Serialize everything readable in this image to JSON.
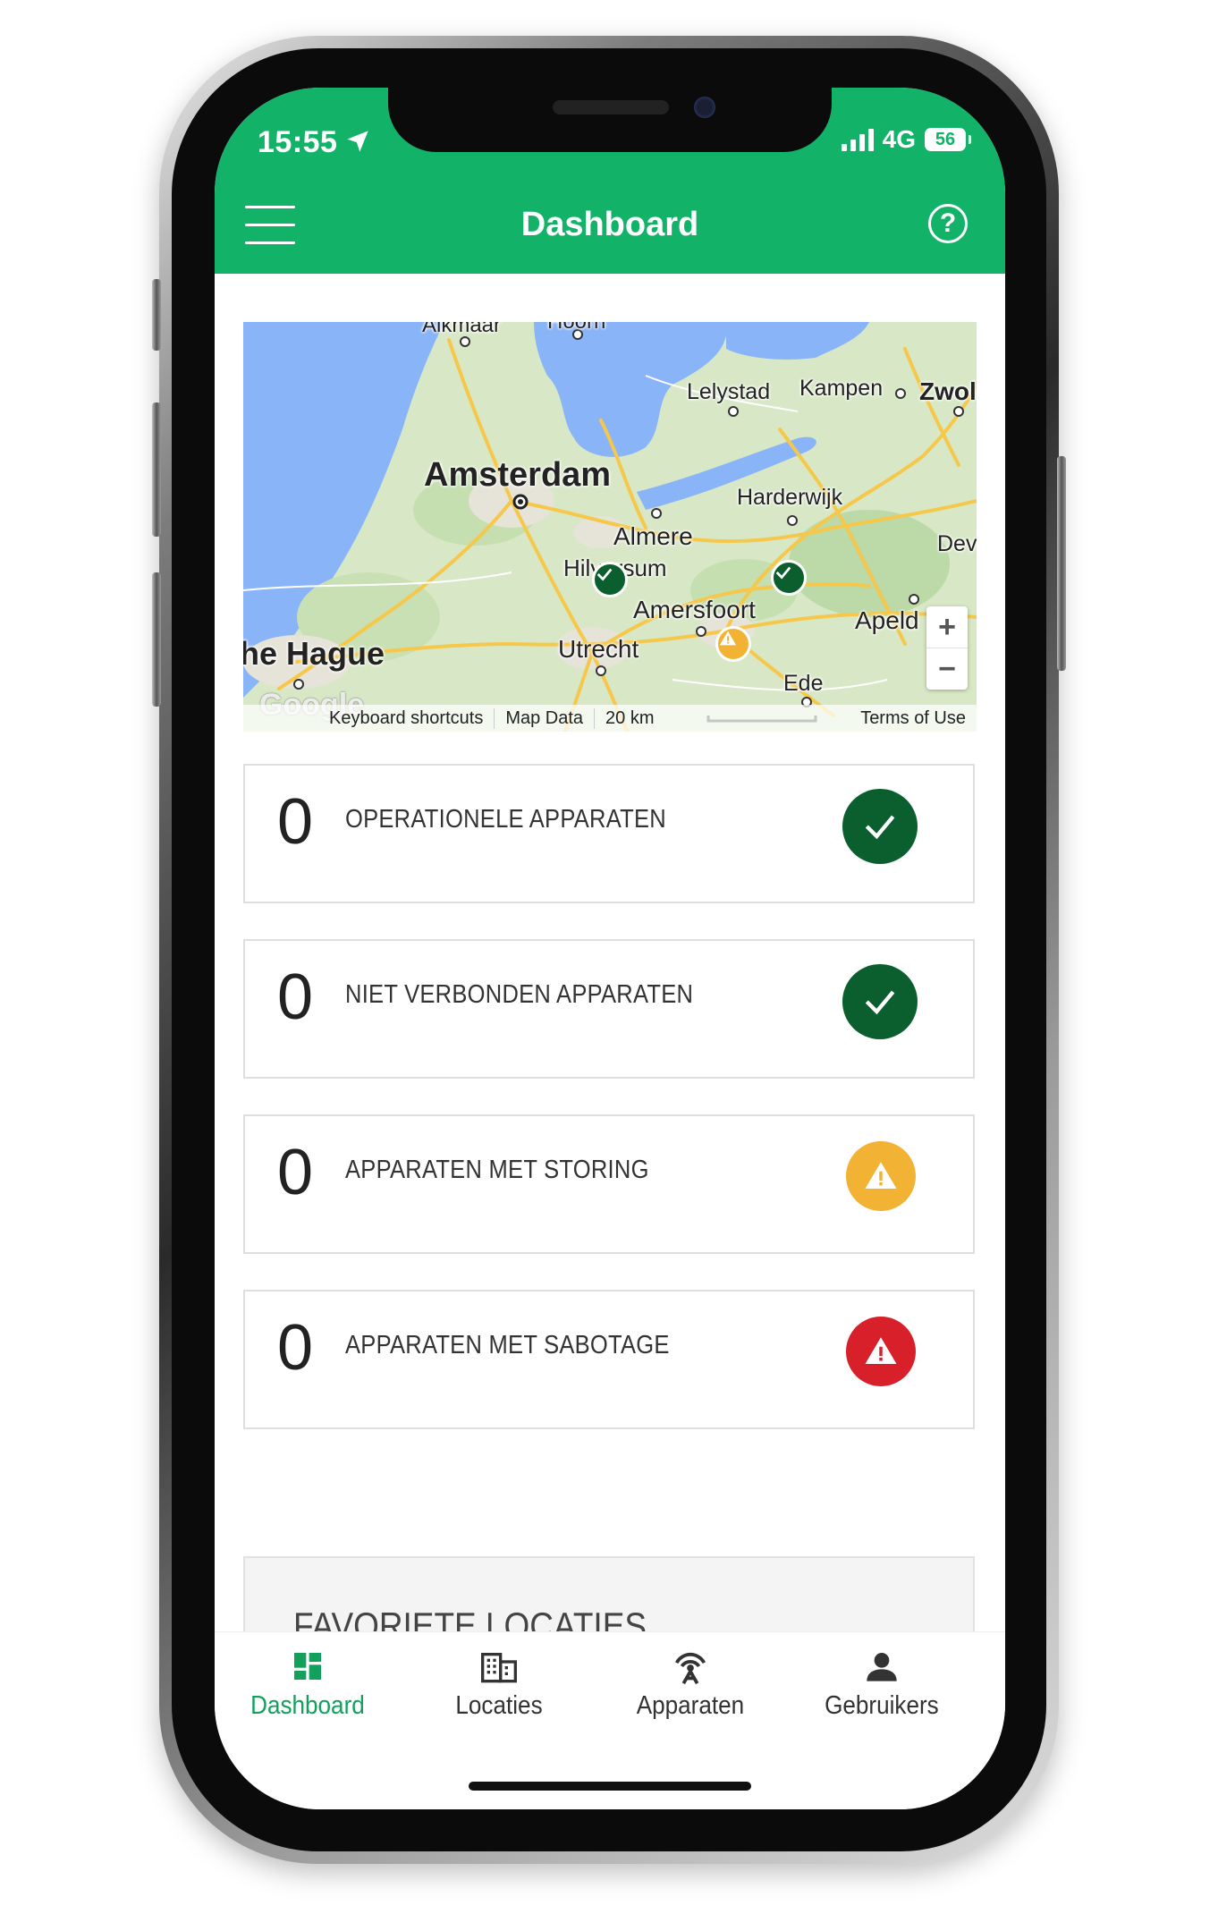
{
  "status_bar": {
    "time": "15:55",
    "network": "4G",
    "battery": "56"
  },
  "header": {
    "title": "Dashboard",
    "menu_icon": "hamburger-menu-icon",
    "help_icon": "help-circle-icon",
    "help_glyph": "?",
    "color": "#12b368"
  },
  "map": {
    "labels": {
      "alkmaar": "Alkmaar",
      "hoorn": "Hoorn",
      "lelystad": "Lelystad",
      "kampen": "Kampen",
      "zwolle": "Zwol",
      "amsterdam": "Amsterdam",
      "harderwijk": "Harderwijk",
      "almere": "Almere",
      "deventer": "Dev",
      "hilversum": "Hilversum",
      "amersfoort": "Amersfoort",
      "apeldoorn": "Apeld",
      "hague": "he Hague",
      "utrecht": "Utrecht",
      "ede": "Ede"
    },
    "markers": [
      {
        "status": "ok",
        "color": "#0b5e2e"
      },
      {
        "status": "ok",
        "color": "#0b5e2e"
      },
      {
        "status": "warning",
        "color": "#f2b233"
      }
    ],
    "zoom_in": "+",
    "zoom_out": "−",
    "google": "Google",
    "footer": {
      "shortcuts": "Keyboard shortcuts",
      "map_data": "Map Data",
      "scale": "20 km",
      "terms": "Terms of Use"
    }
  },
  "cards": [
    {
      "count": "0",
      "label": "OPERATIONELE APPARATEN",
      "icon": "check-icon",
      "color": "#0b5e2e"
    },
    {
      "count": "0",
      "label": "NIET VERBONDEN APPARATEN",
      "icon": "check-icon",
      "color": "#0b5e2e"
    },
    {
      "count": "0",
      "label": "APPARATEN MET STORING",
      "icon": "warning-icon",
      "color": "#f2b233"
    },
    {
      "count": "0",
      "label": "APPARATEN MET SABOTAGE",
      "icon": "warning-icon",
      "color": "#d7202a"
    }
  ],
  "favorites": {
    "title": "FAVORIETE LOCATIES"
  },
  "bottom_nav": [
    {
      "label": "Dashboard",
      "icon": "dashboard-icon",
      "active": true
    },
    {
      "label": "Locaties",
      "icon": "building-icon",
      "active": false
    },
    {
      "label": "Apparaten",
      "icon": "antenna-icon",
      "active": false
    },
    {
      "label": "Gebruikers",
      "icon": "user-icon",
      "active": false
    }
  ],
  "colors": {
    "accent": "#12b368",
    "active_nav": "#12a05c",
    "ok": "#0b5e2e",
    "warning": "#f2b233",
    "danger": "#d7202a"
  }
}
